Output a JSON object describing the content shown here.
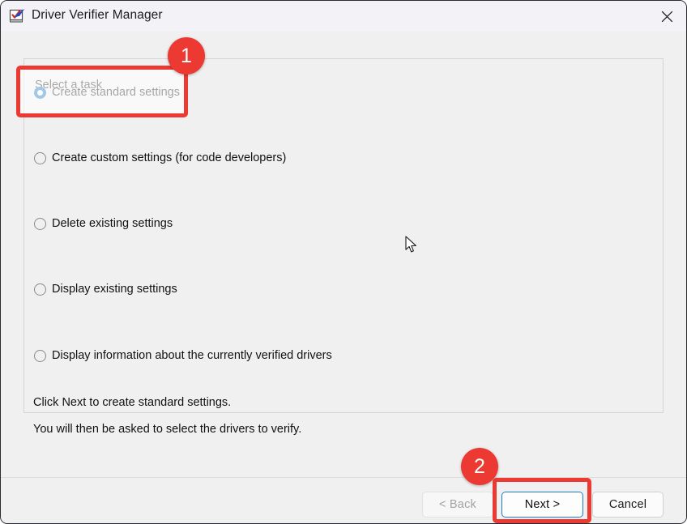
{
  "window": {
    "title": "Driver Verifier Manager",
    "icon": "driver-verifier-icon",
    "close_label": "✕"
  },
  "group": {
    "label": "Select a task",
    "options": [
      {
        "label": "Create standard settings",
        "selected": true
      },
      {
        "label": "Create custom settings (for code developers)",
        "selected": false
      },
      {
        "label": "Delete existing settings",
        "selected": false
      },
      {
        "label": "Display existing settings",
        "selected": false
      },
      {
        "label": "Display information about the currently verified drivers",
        "selected": false
      }
    ]
  },
  "description": {
    "line1": "Click Next to create standard settings.",
    "line2": "You will then be asked to select the drivers to verify."
  },
  "buttons": {
    "back": "< Back",
    "next": "Next >",
    "cancel": "Cancel"
  },
  "annotations": [
    {
      "badge": "1",
      "target": "create-standard-settings-option"
    },
    {
      "badge": "2",
      "target": "next-button"
    }
  ],
  "colors": {
    "accent": "#0f6cbd",
    "annotation_red": "#ec3a32",
    "window_bg": "#f0f0f0",
    "titlebar_bg": "#f3f3f7",
    "next_border": "#1e7ad1"
  }
}
